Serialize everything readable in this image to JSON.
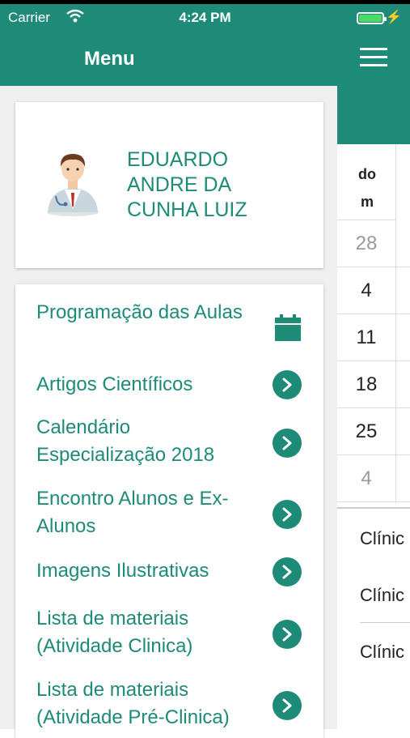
{
  "status_bar": {
    "carrier": "Carrier",
    "time": "4:24 PM"
  },
  "header": {
    "title": "Menu"
  },
  "profile": {
    "name": "EDUARDO ANDRE DA CUNHA LUIZ"
  },
  "menu": {
    "items": [
      {
        "label": "Programação das Aulas",
        "icon": "calendar-icon"
      },
      {
        "label": "Artigos Científicos",
        "icon": "chevron-right-icon"
      },
      {
        "label": "Calendário Especialização 2018",
        "icon": "chevron-right-icon"
      },
      {
        "label": "Encontro Alunos e Ex-Alunos",
        "icon": "chevron-right-icon"
      },
      {
        "label": "Imagens Ilustrativas",
        "icon": "chevron-right-icon"
      },
      {
        "label": "Lista de materiais (Atividade Clinica)",
        "icon": "chevron-right-icon"
      },
      {
        "label": "Lista de materiais (Atividade Pré-Clinica)",
        "icon": "chevron-right-icon"
      }
    ]
  },
  "calendar": {
    "day_header": "do m",
    "days": [
      "28",
      "4",
      "11",
      "18",
      "25",
      "4"
    ],
    "events": [
      "Clínic",
      "Clínic",
      "Clínic"
    ]
  },
  "colors": {
    "accent": "#1e8a78"
  }
}
